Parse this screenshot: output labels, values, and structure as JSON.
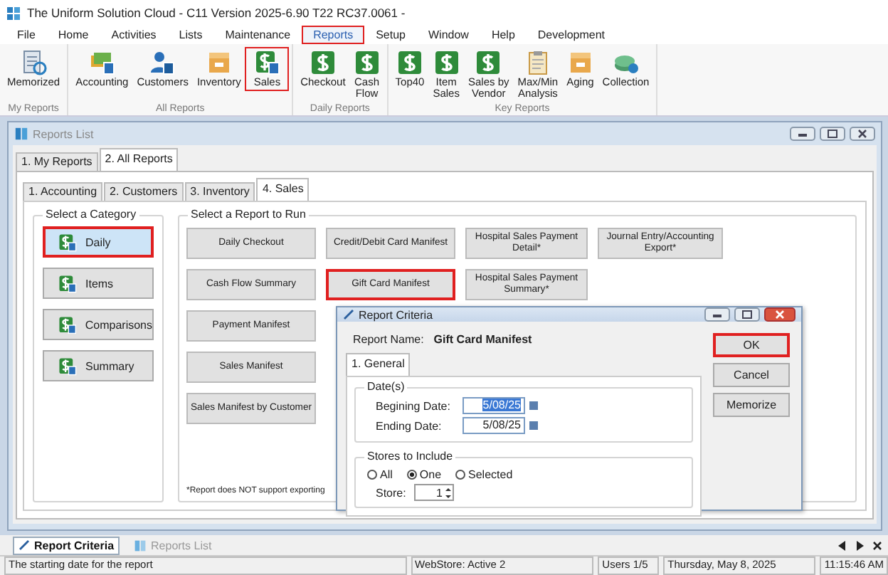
{
  "window": {
    "title": "The Uniform Solution Cloud - C11 Version 2025-6.90 T22 RC37.0061 -"
  },
  "menu": [
    {
      "label": "File",
      "highlighted": false
    },
    {
      "label": "Home",
      "highlighted": false
    },
    {
      "label": "Activities",
      "highlighted": false
    },
    {
      "label": "Lists",
      "highlighted": false
    },
    {
      "label": "Maintenance",
      "highlighted": false
    },
    {
      "label": "Reports",
      "highlighted": true
    },
    {
      "label": "Setup",
      "highlighted": false
    },
    {
      "label": "Window",
      "highlighted": false
    },
    {
      "label": "Help",
      "highlighted": false
    },
    {
      "label": "Development",
      "highlighted": false
    }
  ],
  "ribbon": [
    {
      "label": "My Reports",
      "buttons": [
        {
          "label": "Memorized",
          "kind": "report",
          "highlighted": false
        }
      ]
    },
    {
      "label": "All Reports",
      "buttons": [
        {
          "label": "Accounting",
          "kind": "money-card",
          "highlighted": false
        },
        {
          "label": "Customers",
          "kind": "people",
          "highlighted": false
        },
        {
          "label": "Inventory",
          "kind": "box",
          "highlighted": false
        },
        {
          "label": "Sales",
          "kind": "dollar-card",
          "highlighted": true
        }
      ]
    },
    {
      "label": "Daily Reports",
      "buttons": [
        {
          "label": "Checkout",
          "kind": "dollar",
          "highlighted": false
        },
        {
          "label": "Cash\nFlow",
          "kind": "dollar",
          "highlighted": false
        }
      ]
    },
    {
      "label": "Key Reports",
      "buttons": [
        {
          "label": "Top40",
          "kind": "dollar",
          "highlighted": false
        },
        {
          "label": "Item\nSales",
          "kind": "dollar",
          "highlighted": false
        },
        {
          "label": "Sales by\nVendor",
          "kind": "dollar",
          "highlighted": false
        },
        {
          "label": "Max/Min\nAnalysis",
          "kind": "clipboard",
          "highlighted": false
        },
        {
          "label": "Aging",
          "kind": "box",
          "highlighted": false
        },
        {
          "label": "Collection",
          "kind": "money",
          "highlighted": false
        }
      ]
    }
  ],
  "reports_window": {
    "title": "Reports List",
    "tabs": [
      {
        "label": "1. My Reports",
        "selected": false
      },
      {
        "label": "2. All Reports",
        "selected": true
      }
    ],
    "sub_tabs": [
      {
        "label": "1. Accounting",
        "selected": false
      },
      {
        "label": "2. Customers",
        "selected": false
      },
      {
        "label": "3. Inventory",
        "selected": false
      },
      {
        "label": "4. Sales",
        "selected": true
      }
    ],
    "category_title": "Select a Category",
    "categories": [
      {
        "label": "Daily",
        "selected": true,
        "highlighted": true
      },
      {
        "label": "Items",
        "selected": false,
        "highlighted": false
      },
      {
        "label": "Comparisons",
        "selected": false,
        "highlighted": false
      },
      {
        "label": "Summary",
        "selected": false,
        "highlighted": false
      }
    ],
    "reports_title": "Select a Report to Run",
    "report_columns": [
      [
        {
          "label": "Daily Checkout",
          "highlighted": false
        },
        {
          "label": "Cash Flow Summary",
          "highlighted": false
        },
        {
          "label": "Payment Manifest",
          "highlighted": false
        },
        {
          "label": "Sales Manifest",
          "highlighted": false
        },
        {
          "label": "Sales Manifest by Customer",
          "highlighted": false
        }
      ],
      [
        {
          "label": "Credit/Debit Card Manifest",
          "highlighted": false
        },
        {
          "label": "Gift Card Manifest",
          "highlighted": true
        }
      ],
      [
        {
          "label": "Hospital Sales Payment\nDetail*",
          "highlighted": false
        },
        {
          "label": "Hospital Sales Payment\nSummary*",
          "highlighted": false
        }
      ],
      [
        {
          "label": "Journal Entry/Accounting\nExport*",
          "highlighted": false
        }
      ]
    ],
    "note": "*Report does NOT support exporting"
  },
  "dialog": {
    "title": "Report Criteria",
    "report_name_label": "Report Name:",
    "report_name": "Gift Card Manifest",
    "tabs": [
      {
        "label": "1. General",
        "selected": true
      }
    ],
    "dates_title": "Date(s)",
    "dates": [
      {
        "label": "Begining Date:",
        "value": "5/08/25",
        "selected": true
      },
      {
        "label": "Ending Date:",
        "value": "5/08/25",
        "selected": false
      }
    ],
    "stores_title": "Stores to Include",
    "store_options": [
      {
        "label": "All",
        "selected": false
      },
      {
        "label": "One",
        "selected": true
      },
      {
        "label": "Selected",
        "selected": false
      }
    ],
    "store_label": "Store:",
    "store_value": "1",
    "buttons": [
      {
        "label": "OK",
        "highlighted": true
      },
      {
        "label": "Cancel",
        "highlighted": false
      },
      {
        "label": "Memorize",
        "highlighted": false
      }
    ]
  },
  "taskbar": [
    {
      "label": "Report Criteria",
      "selected": true,
      "kind": "pencil"
    },
    {
      "label": "Reports List",
      "selected": false,
      "kind": "logo"
    }
  ],
  "status_bar": [
    "The starting date for the report",
    "WebStore:  Active 2",
    "Users 1/5",
    "Thursday, May  8, 2025",
    "11:15:46 AM"
  ]
}
